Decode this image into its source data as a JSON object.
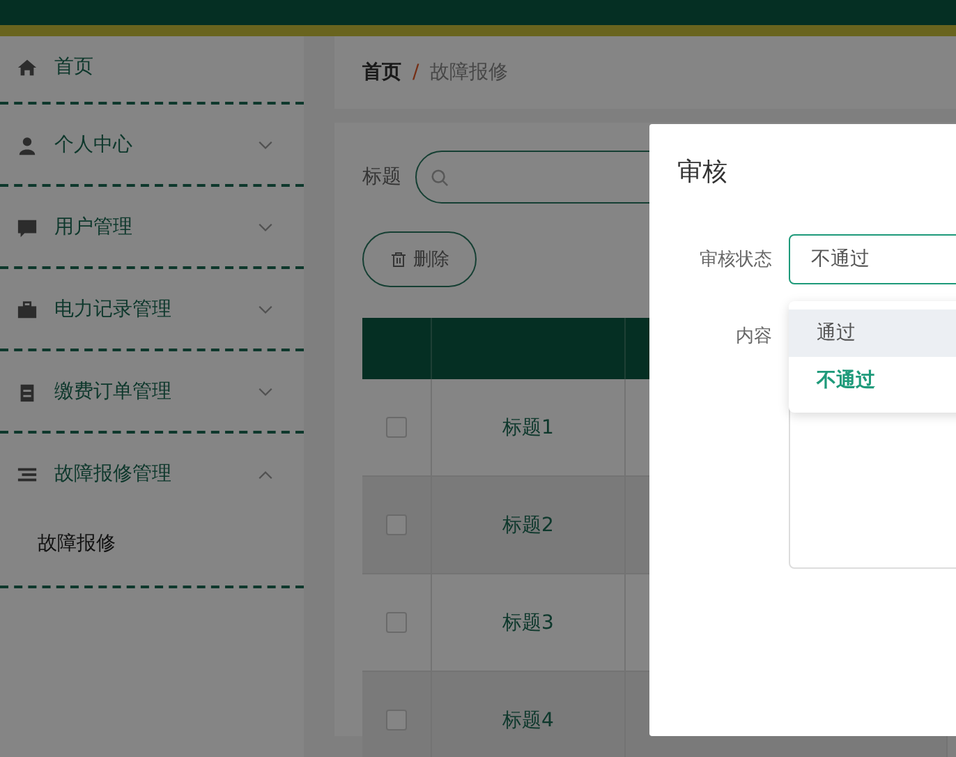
{
  "sidebar": {
    "items": [
      {
        "kind": "home",
        "label": "首页"
      },
      {
        "kind": "user",
        "label": "个人中心",
        "expanded": false
      },
      {
        "kind": "chat",
        "label": "用户管理",
        "expanded": false
      },
      {
        "kind": "briefcase",
        "label": "电力记录管理",
        "expanded": false
      },
      {
        "kind": "clipboard",
        "label": "缴费订单管理",
        "expanded": false
      },
      {
        "kind": "list",
        "label": "故障报修管理",
        "expanded": true,
        "children": [
          {
            "label": "故障报修"
          }
        ]
      }
    ]
  },
  "breadcrumb": {
    "items": [
      "首页",
      "故障报修"
    ],
    "separator": "/"
  },
  "search": {
    "label": "标题"
  },
  "delete_button": {
    "label": "删除"
  },
  "table": {
    "rows": [
      {
        "checked": false,
        "title": "标题1"
      },
      {
        "checked": false,
        "title": "标题2"
      },
      {
        "checked": false,
        "title": "标题3"
      },
      {
        "checked": false,
        "title": "标题4"
      }
    ]
  },
  "dialog": {
    "title": "审核",
    "status_label": "审核状态",
    "status_value": "不通过",
    "content_label": "内容",
    "options": [
      {
        "label": "通过",
        "hovered": true,
        "selected": false
      },
      {
        "label": "不通过",
        "hovered": false,
        "selected": true
      }
    ]
  }
}
